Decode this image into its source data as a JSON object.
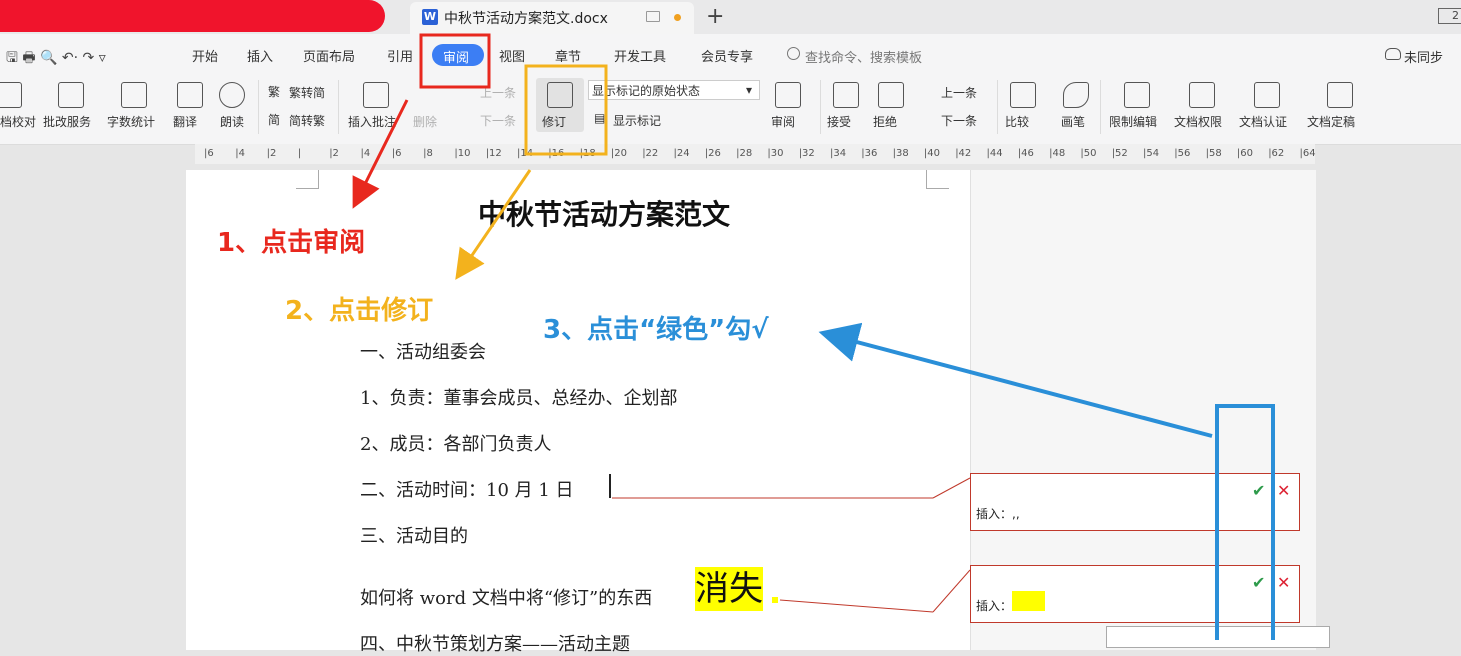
{
  "tab": {
    "title": "中秋节活动方案范文.docx",
    "new_tab": "+",
    "window_counter": "2"
  },
  "menu": {
    "items": [
      "开始",
      "插入",
      "页面布局",
      "引用",
      "审阅",
      "视图",
      "章节",
      "开发工具",
      "会员专享"
    ],
    "search_placeholder": "查找命令、搜索模板",
    "sync": "未同步"
  },
  "ribbon": {
    "proofread": "档校对",
    "revise_service": "批改服务",
    "word_count": "字数统计",
    "translate": "翻译",
    "read_aloud": "朗读",
    "trad_to_simp": "繁转简",
    "simp_to_trad": "简转繁",
    "insert_comment": "插入批注",
    "delete": "删除",
    "prev_comment": "上一条",
    "next_comment": "下一条",
    "track_changes": "修订",
    "markup_state": "显示标记的原始状态",
    "show_markup": "显示标记",
    "review_pane": "审阅",
    "accept": "接受",
    "reject": "拒绝",
    "prev_change": "上一条",
    "next_change": "下一条",
    "compare": "比较",
    "ink": "画笔",
    "restrict_edit": "限制编辑",
    "doc_permission": "文档权限",
    "doc_certify": "文档认证",
    "doc_finalize": "文档定稿"
  },
  "ruler": {
    "ticks": [
      "6",
      "4",
      "2",
      "",
      "2",
      "4",
      "6",
      "8",
      "10",
      "12",
      "14",
      "16",
      "18",
      "20",
      "22",
      "24",
      "26",
      "28",
      "30",
      "32",
      "34",
      "36",
      "38",
      "40",
      "42",
      "44",
      "46",
      "48",
      "50",
      "52",
      "54",
      "56",
      "58",
      "60",
      "62",
      "64"
    ]
  },
  "document": {
    "title": "中秋节活动方案范文",
    "p1": "一、活动组委会",
    "p2": "1、负责：董事会成员、总经办、企划部",
    "p3": "2、成员：各部门负责人",
    "p4": "二、活动时间：10 月 1 日",
    "p5": "三、活动目的",
    "p6": "如何将 word 文档中将“修订”的东西",
    "big_word": "消失",
    "p7": "四、中秋节策划方案——活动主题"
  },
  "revisions": [
    {
      "label": "插入：,,"
    },
    {
      "label": "插入："
    }
  ],
  "annotations": {
    "step1": "1、点击审阅",
    "step2": "2、点击修订",
    "step3": "3、点击“绿色”勾√"
  },
  "colors": {
    "red": "#e8281e",
    "orange": "#f3b21d",
    "blue": "#2a8fd8",
    "accent": "#3c7ef4",
    "green": "#2e9b4b"
  }
}
